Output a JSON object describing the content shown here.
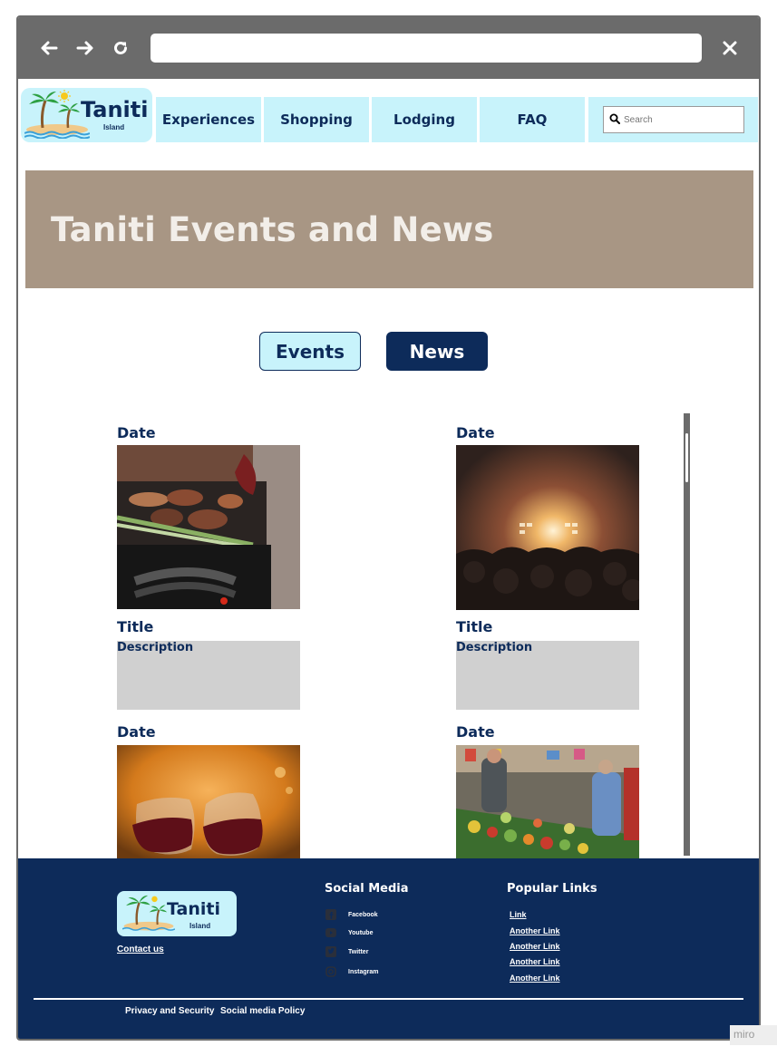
{
  "browser": {
    "back_icon": "arrow-left-icon",
    "forward_icon": "arrow-right-icon",
    "reload_icon": "reload-icon",
    "close_icon": "close-icon",
    "url": ""
  },
  "header": {
    "logo_name": "Taniti",
    "logo_sub": "Island",
    "nav": [
      "Experiences",
      "Shopping",
      "Lodging",
      "FAQ"
    ],
    "search_placeholder": "Search"
  },
  "hero": {
    "title": "Taniti Events and News"
  },
  "tabs": {
    "events": "Events",
    "news": "News"
  },
  "cards": [
    {
      "date": "Date",
      "image": "barbecue-grill-photo",
      "title": "Title",
      "description": "Description"
    },
    {
      "date": "Date",
      "image": "concert-crowd-photo",
      "title": "Title",
      "description": "Description"
    },
    {
      "date": "Date",
      "image": "wine-glasses-photo"
    },
    {
      "date": "Date",
      "image": "market-stall-photo"
    }
  ],
  "footer": {
    "logo_name": "Taniti",
    "logo_sub": "Island",
    "contact": "Contact us",
    "social_heading": "Social Media",
    "social": [
      {
        "label": "Facebook",
        "icon": "facebook-icon"
      },
      {
        "label": "Youtube",
        "icon": "youtube-icon"
      },
      {
        "label": "Twitter",
        "icon": "twitter-icon"
      },
      {
        "label": "Instagram",
        "icon": "instagram-icon"
      }
    ],
    "links_heading": "Popular Links",
    "links": [
      "Link",
      "Another Link",
      "Another Link",
      "Another Link",
      "Another Link"
    ],
    "legal": [
      "Privacy and Security",
      "Social media Policy"
    ]
  },
  "watermark": "miro",
  "colors": {
    "navy": "#0d2b5a",
    "light_cyan": "#c8f3fb",
    "hero_tan": "#a89684",
    "chrome_gray": "#6b6b6b",
    "description_gray": "#d0d0d0"
  }
}
